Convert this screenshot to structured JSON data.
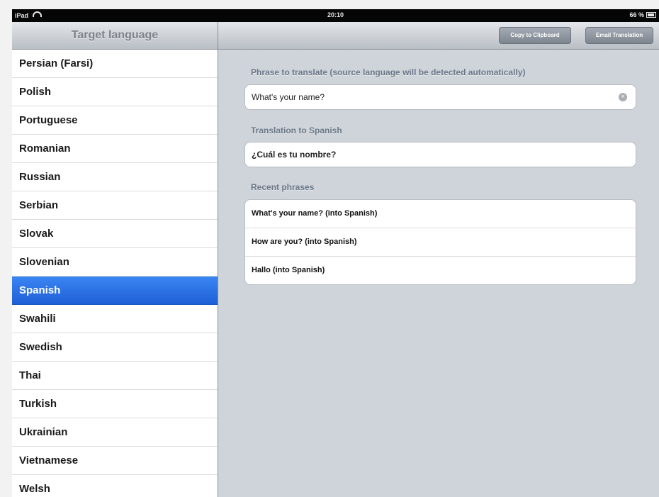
{
  "status_bar": {
    "device": "iPad",
    "time": "20:10",
    "battery": "66 %"
  },
  "left_pane": {
    "title": "Target language",
    "languages": [
      "Persian (Farsi)",
      "Polish",
      "Portuguese",
      "Romanian",
      "Russian",
      "Serbian",
      "Slovak",
      "Slovenian",
      "Spanish",
      "Swahili",
      "Swedish",
      "Thai",
      "Turkish",
      "Ukrainian",
      "Vietnamese",
      "Welsh"
    ],
    "selected": "Spanish"
  },
  "toolbar": {
    "copy_label": "Copy to Clipboard",
    "email_label": "Email Translation"
  },
  "main": {
    "phrase_label": "Phrase to translate (source language will be detected automatically)",
    "phrase_value": "What's your name?",
    "translation_label": "Translation to Spanish",
    "translation_value": "¿Cuál es tu nombre?",
    "recent_label": "Recent phrases",
    "recent": [
      "What's your name? (into Spanish)",
      "How are you? (into Spanish)",
      "Hallo (into Spanish)"
    ]
  },
  "colors": {
    "selection": "#2a6fe4",
    "section_label": "#6b7787",
    "background": "#cfd4da"
  },
  "icons": {
    "clear": "clear-circle-icon",
    "wifi": "wifi-icon",
    "battery": "battery-icon"
  }
}
